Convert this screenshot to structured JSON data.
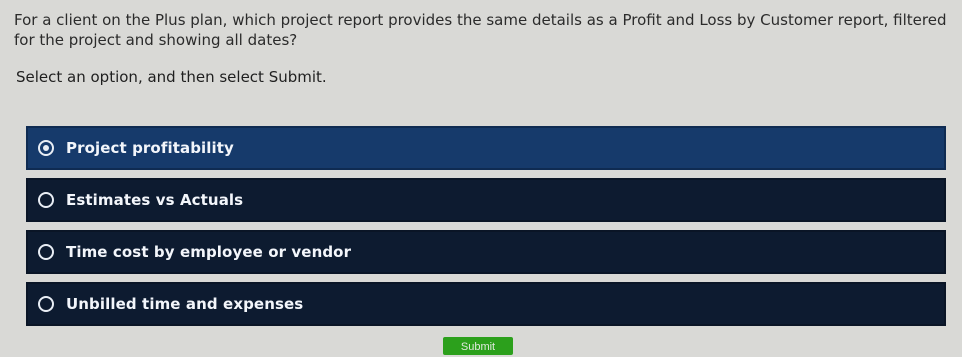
{
  "question": "For a client on the Plus plan, which project report provides the same details as a Profit and Loss by Customer report, filtered for the project and showing all dates?",
  "instruction": "Select an option, and then select Submit.",
  "options": [
    {
      "label": "Project profitability",
      "selected": true
    },
    {
      "label": "Estimates vs Actuals",
      "selected": false
    },
    {
      "label": "Time cost by employee or vendor",
      "selected": false
    },
    {
      "label": "Unbilled time and expenses",
      "selected": false
    }
  ],
  "submit_label": "Submit",
  "colors": {
    "selected_option": "#163a6b",
    "option": "#0d1b30",
    "submit": "#2ca01c",
    "background": "#d9d9d6"
  }
}
